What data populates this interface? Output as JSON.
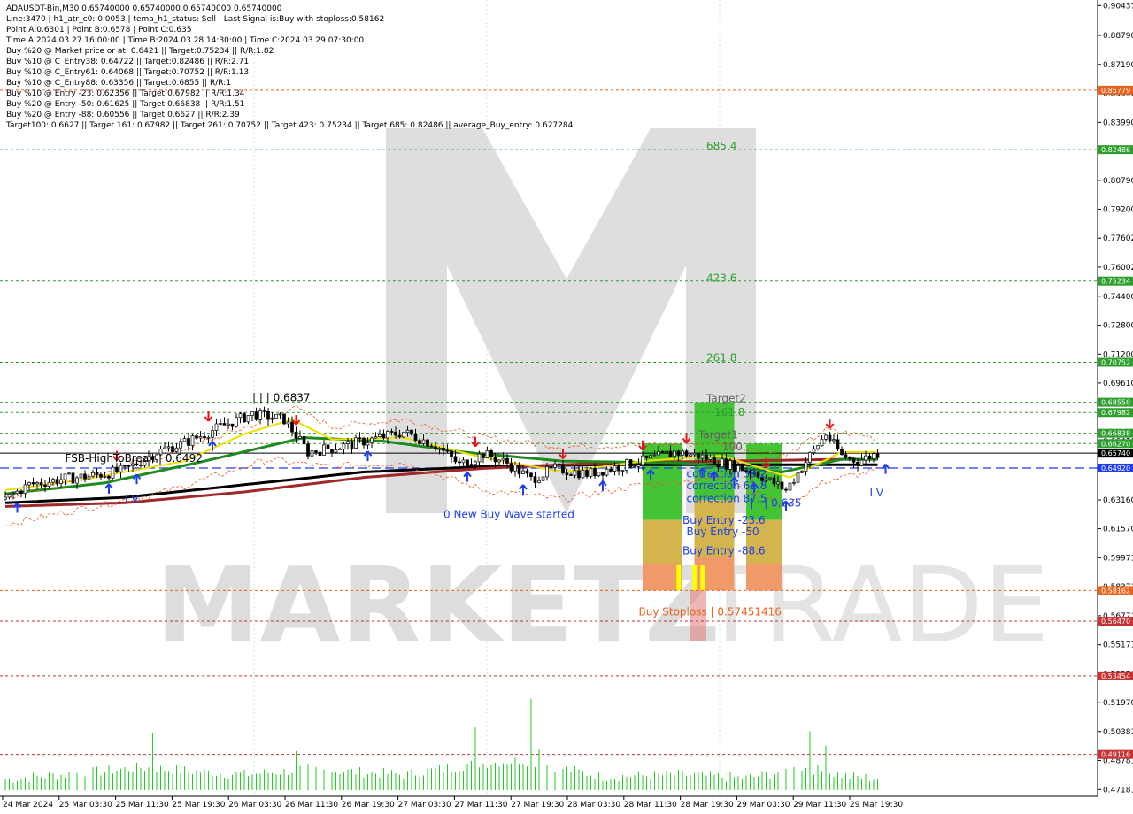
{
  "header": {
    "lines": [
      "ADAUSDT-Bin,M30  0.65740000 0.65740000 0.65740000 0.65740000",
      "Line:3470  |  h1_atr_c0: 0.0053  |  tema_h1_status: Sell  |  Last Signal is:Buy with stoploss:0.58162",
      "Point A:0.6301  |  Point B:0.6578  |  Point C:0.635",
      "Time A:2024.03.27 16:00:00  |  Time B:2024.03.28 14:30:00  |  Time C:2024.03.29 07:30:00",
      "Buy %20 @ Market price or at: 0.6421  ||  Target:0.75234  ||  R/R:1.82",
      "Buy %10 @ C_Entry38: 0.64722  ||  Target:0.82486  ||  R/R:2.71",
      "Buy %10 @ C_Entry61: 0.64068  ||  Target:0.70752  ||  R/R:1.13",
      "Buy %10 @ C_Entry88: 0.63356  ||  Target:0.6855  ||  R/R:1",
      "Buy %10 @ Entry -23: 0.62356  ||  Target:0.67982  ||  R/R:1.34",
      "Buy %20 @ Entry -50: 0.61625  ||  Target:0.66838  ||  R/R:1.51",
      "Buy %20 @ Entry -88: 0.60556  ||  Target:0.6627  ||  R/R:2.39",
      "Target100: 0.6627  ||  Target 161: 0.67982  ||  Target 261: 0.70752  ||  Target 423: 0.75234  ||  Target 685: 0.82486  ||  average_Buy_entry: 0.627284"
    ]
  },
  "watermark": {
    "brand": "MARKETZ",
    "suffix": "TRADE"
  },
  "axis": {
    "y_ticks": [
      "0.90437",
      "0.88790",
      "0.87190",
      "0.85590",
      "0.83990",
      "0.82390",
      "0.80790",
      "0.79200",
      "0.77602",
      "0.76002",
      "0.74400",
      "0.72800",
      "0.71200",
      "0.69610",
      "0.68010",
      "0.66410",
      "0.64810",
      "0.63160",
      "0.61570",
      "0.59971",
      "0.58371",
      "0.56771",
      "0.55171",
      "0.53570",
      "0.51970",
      "0.50381",
      "0.48781",
      "0.47181"
    ],
    "x_ticks": [
      "24 Mar 2024",
      "25 Mar 03:30",
      "25 Mar 11:30",
      "25 Mar 19:30",
      "26 Mar 03:30",
      "26 Mar 11:30",
      "26 Mar 19:30",
      "27 Mar 03:30",
      "27 Mar 11:30",
      "27 Mar 19:30",
      "28 Mar 03:30",
      "28 Mar 11:30",
      "28 Mar 19:30",
      "29 Mar 03:30",
      "29 Mar 11:30",
      "29 Mar 19:30"
    ]
  },
  "chart_data": {
    "type": "candlestick",
    "symbol": "ADAUSDT-Bin",
    "timeframe": "M30",
    "ylim": [
      0.4705,
      0.905
    ],
    "x_count": 220,
    "price_lines": [
      {
        "value": 0.8577,
        "label": "0.85779",
        "color": "#e8641e",
        "style": "dashed"
      },
      {
        "value": 0.82486,
        "label": "0.82486",
        "color": "#2e9e2e",
        "style": "dashed"
      },
      {
        "value": 0.75234,
        "label": "0.75234",
        "color": "#2e9e2e",
        "style": "dashed"
      },
      {
        "value": 0.70752,
        "label": "0.70752",
        "color": "#2e9e2e",
        "style": "dashed"
      },
      {
        "value": 0.6855,
        "label": "0.68550",
        "color": "#2e9e2e",
        "style": "dashed"
      },
      {
        "value": 0.67982,
        "label": "0.67982",
        "color": "#2e9e2e",
        "style": "dashed"
      },
      {
        "value": 0.66838,
        "label": "0.66838",
        "color": "#2e9e2e",
        "style": "dashed"
      },
      {
        "value": 0.6627,
        "label": "0.66270",
        "color": "#2e9e2e",
        "style": "dashed"
      },
      {
        "value": 0.6574,
        "label": "0.65740",
        "color": "#000000",
        "style": "solid"
      },
      {
        "value": 0.6492,
        "label": "0.64920",
        "color": "#1e3cf0",
        "style": "dashed"
      },
      {
        "value": 0.58162,
        "label": "0.58162",
        "color": "#e8641e",
        "style": "dashed"
      },
      {
        "value": 0.5647,
        "label": "0.56470",
        "color": "#c83232",
        "style": "dashed"
      },
      {
        "value": 0.53454,
        "label": "0.53454",
        "color": "#c83232",
        "style": "dashed"
      },
      {
        "value": 0.49116,
        "label": "0.49116",
        "color": "#c83232",
        "style": "dashed"
      }
    ],
    "anchor_closes": [
      [
        0,
        0.632
      ],
      [
        6,
        0.64
      ],
      [
        14,
        0.643
      ],
      [
        22,
        0.645
      ],
      [
        30,
        0.648
      ],
      [
        38,
        0.658
      ],
      [
        46,
        0.664
      ],
      [
        54,
        0.672
      ],
      [
        62,
        0.679
      ],
      [
        70,
        0.676
      ],
      [
        76,
        0.658
      ],
      [
        84,
        0.661
      ],
      [
        92,
        0.665
      ],
      [
        100,
        0.669
      ],
      [
        108,
        0.662
      ],
      [
        114,
        0.651
      ],
      [
        120,
        0.657
      ],
      [
        126,
        0.652
      ],
      [
        132,
        0.643
      ],
      [
        138,
        0.649
      ],
      [
        146,
        0.646
      ],
      [
        152,
        0.649
      ],
      [
        160,
        0.653
      ],
      [
        168,
        0.658
      ],
      [
        174,
        0.656
      ],
      [
        180,
        0.652
      ],
      [
        188,
        0.647
      ],
      [
        196,
        0.637
      ],
      [
        202,
        0.656
      ],
      [
        206,
        0.668
      ],
      [
        210,
        0.656
      ],
      [
        214,
        0.653
      ],
      [
        219,
        0.6574
      ]
    ],
    "volume_anchors": [
      [
        0,
        0.4775
      ],
      [
        20,
        0.481
      ],
      [
        34,
        0.484
      ],
      [
        60,
        0.48
      ],
      [
        76,
        0.483
      ],
      [
        100,
        0.48
      ],
      [
        118,
        0.486
      ],
      [
        130,
        0.488
      ],
      [
        150,
        0.479
      ],
      [
        170,
        0.48
      ],
      [
        186,
        0.478
      ],
      [
        200,
        0.484
      ],
      [
        212,
        0.479
      ],
      [
        219,
        0.478
      ]
    ],
    "volume_spikes": [
      [
        17,
        0.4955
      ],
      [
        37,
        0.503
      ],
      [
        73,
        0.493
      ],
      [
        118,
        0.506
      ],
      [
        132,
        0.522
      ],
      [
        134,
        0.494
      ],
      [
        202,
        0.504
      ],
      [
        206,
        0.496
      ]
    ],
    "ma_lines": [
      {
        "name": "",
        "color": "#000000",
        "anchors": [
          [
            0,
            0.63
          ],
          [
            30,
            0.633
          ],
          [
            60,
            0.64
          ],
          [
            90,
            0.647
          ],
          [
            120,
            0.65
          ],
          [
            150,
            0.651
          ],
          [
            180,
            0.651
          ],
          [
            219,
            0.651
          ]
        ]
      },
      {
        "name": "",
        "color": "#a02828",
        "anchors": [
          [
            0,
            0.628
          ],
          [
            30,
            0.63
          ],
          [
            60,
            0.636
          ],
          [
            90,
            0.644
          ],
          [
            120,
            0.649
          ],
          [
            150,
            0.652
          ],
          [
            180,
            0.653
          ],
          [
            210,
            0.654
          ],
          [
            219,
            0.654
          ]
        ]
      },
      {
        "name": "",
        "color": "#1f8a1f",
        "anchors": [
          [
            0,
            0.635
          ],
          [
            25,
            0.641
          ],
          [
            50,
            0.653
          ],
          [
            75,
            0.666
          ],
          [
            95,
            0.664
          ],
          [
            115,
            0.658
          ],
          [
            140,
            0.653
          ],
          [
            170,
            0.652
          ],
          [
            195,
            0.647
          ],
          [
            210,
            0.654
          ],
          [
            219,
            0.654
          ]
        ]
      },
      {
        "name": "",
        "color": "#f0e000",
        "anchors": [
          [
            0,
            0.637
          ],
          [
            20,
            0.643
          ],
          [
            45,
            0.653
          ],
          [
            60,
            0.668
          ],
          [
            72,
            0.676
          ],
          [
            82,
            0.665
          ],
          [
            100,
            0.666
          ],
          [
            118,
            0.656
          ],
          [
            140,
            0.647
          ],
          [
            160,
            0.653
          ],
          [
            180,
            0.656
          ],
          [
            197,
            0.644
          ],
          [
            210,
            0.658
          ],
          [
            219,
            0.658
          ]
        ]
      }
    ],
    "fib_boxes": [
      {
        "x0": 160,
        "x1": 170,
        "top": 0.6627,
        "bottom": 0.5816
      },
      {
        "x0": 173,
        "x1": 183,
        "top": 0.6855,
        "bottom": 0.5816
      },
      {
        "x0": 186,
        "x1": 195,
        "top": 0.6627,
        "bottom": 0.5816
      }
    ],
    "stoploss_box": {
      "x0": 172,
      "x1": 176,
      "top": 0.5816,
      "bottom": 0.554
    },
    "annotations": [
      {
        "text": "685.4",
        "x": 176,
        "y": 0.825,
        "color": "#2e9e2e",
        "anchor": "start"
      },
      {
        "text": "423.6",
        "x": 176,
        "y": 0.752,
        "color": "#2e9e2e",
        "anchor": "start"
      },
      {
        "text": "261.8",
        "x": 176,
        "y": 0.708,
        "color": "#2e9e2e",
        "anchor": "start"
      },
      {
        "text": "Target2",
        "x": 176,
        "y": 0.6855,
        "color": "#606060",
        "anchor": "start"
      },
      {
        "text": "161.8",
        "x": 178,
        "y": 0.678,
        "color": "#2e9e2e",
        "anchor": "start"
      },
      {
        "text": "Target1",
        "x": 174,
        "y": 0.6655,
        "color": "#606060",
        "anchor": "start"
      },
      {
        "text": "100",
        "x": 180,
        "y": 0.659,
        "color": "#606060",
        "anchor": "start"
      },
      {
        "text": "| | | 0.6837",
        "x": 62,
        "y": 0.686,
        "color": "#000000",
        "anchor": "start"
      },
      {
        "text": "FSB-HighToBreak  |  0.6492",
        "x": 15,
        "y": 0.6525,
        "color": "#000000",
        "anchor": "start"
      },
      {
        "text": "I V",
        "x": 30,
        "y": 0.63,
        "color": "#1e3cf0",
        "anchor": "start"
      },
      {
        "text": "0 New Buy Wave started",
        "x": 110,
        "y": 0.6215,
        "color": "#1e3cf0",
        "anchor": "start"
      },
      {
        "text": "correction 38.2",
        "x": 171,
        "y": 0.644,
        "color": "#1e3cf0",
        "anchor": "start"
      },
      {
        "text": "correction 61.8",
        "x": 171,
        "y": 0.6375,
        "color": "#1e3cf0",
        "anchor": "start"
      },
      {
        "text": "correction 87.5",
        "x": 171,
        "y": 0.6305,
        "color": "#1e3cf0",
        "anchor": "start"
      },
      {
        "text": "| | | 0.635",
        "x": 187,
        "y": 0.628,
        "color": "#1e3cf0",
        "anchor": "start"
      },
      {
        "text": "Buy Entry -23.6",
        "x": 170,
        "y": 0.6185,
        "color": "#1e3cf0",
        "anchor": "start"
      },
      {
        "text": "Buy Entry -50",
        "x": 171,
        "y": 0.612,
        "color": "#1e3cf0",
        "anchor": "start"
      },
      {
        "text": "Buy Entry -88.6",
        "x": 170,
        "y": 0.6015,
        "color": "#1e3cf0",
        "anchor": "start"
      },
      {
        "text": "I V",
        "x": 217,
        "y": 0.6335,
        "color": "#1e3cf0",
        "anchor": "start"
      },
      {
        "text": "Buy Stoploss | 0.57451416",
        "x": 159,
        "y": 0.568,
        "color": "#e8641e",
        "anchor": "start"
      }
    ],
    "buy_arrows": [
      3,
      26,
      33,
      52,
      91,
      116,
      130,
      150,
      162,
      175,
      178,
      183,
      188,
      196,
      221
    ],
    "sell_arrows": [
      28,
      51,
      73,
      118,
      140,
      160,
      171,
      191,
      207
    ]
  }
}
